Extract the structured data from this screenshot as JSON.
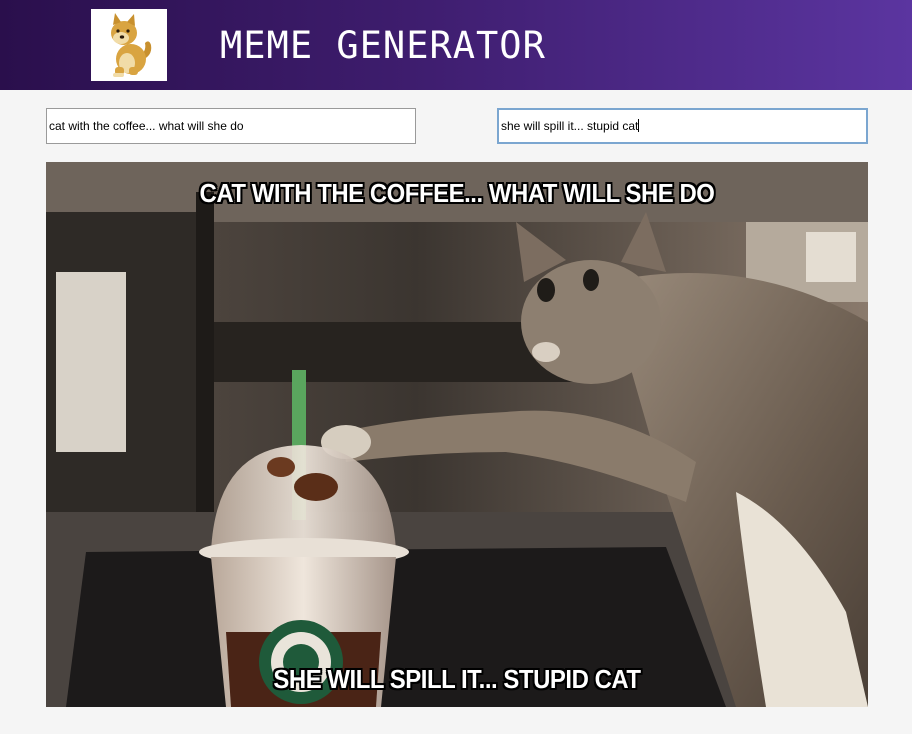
{
  "header": {
    "title": "MEME GENERATOR",
    "logo_icon": "doge-logo-icon",
    "gradient": [
      "#2a0f4c",
      "#5b35a0"
    ]
  },
  "inputs": {
    "top_text": "cat with the coffee... what will she do",
    "bottom_text": "she will spill it... stupid cat"
  },
  "meme": {
    "image": "cat-with-frappuccino-image",
    "top_caption": "CAT WITH THE COFFEE... WHAT WILL SHE DO",
    "bottom_caption": "SHE WILL SPILL IT... STUPID CAT"
  }
}
